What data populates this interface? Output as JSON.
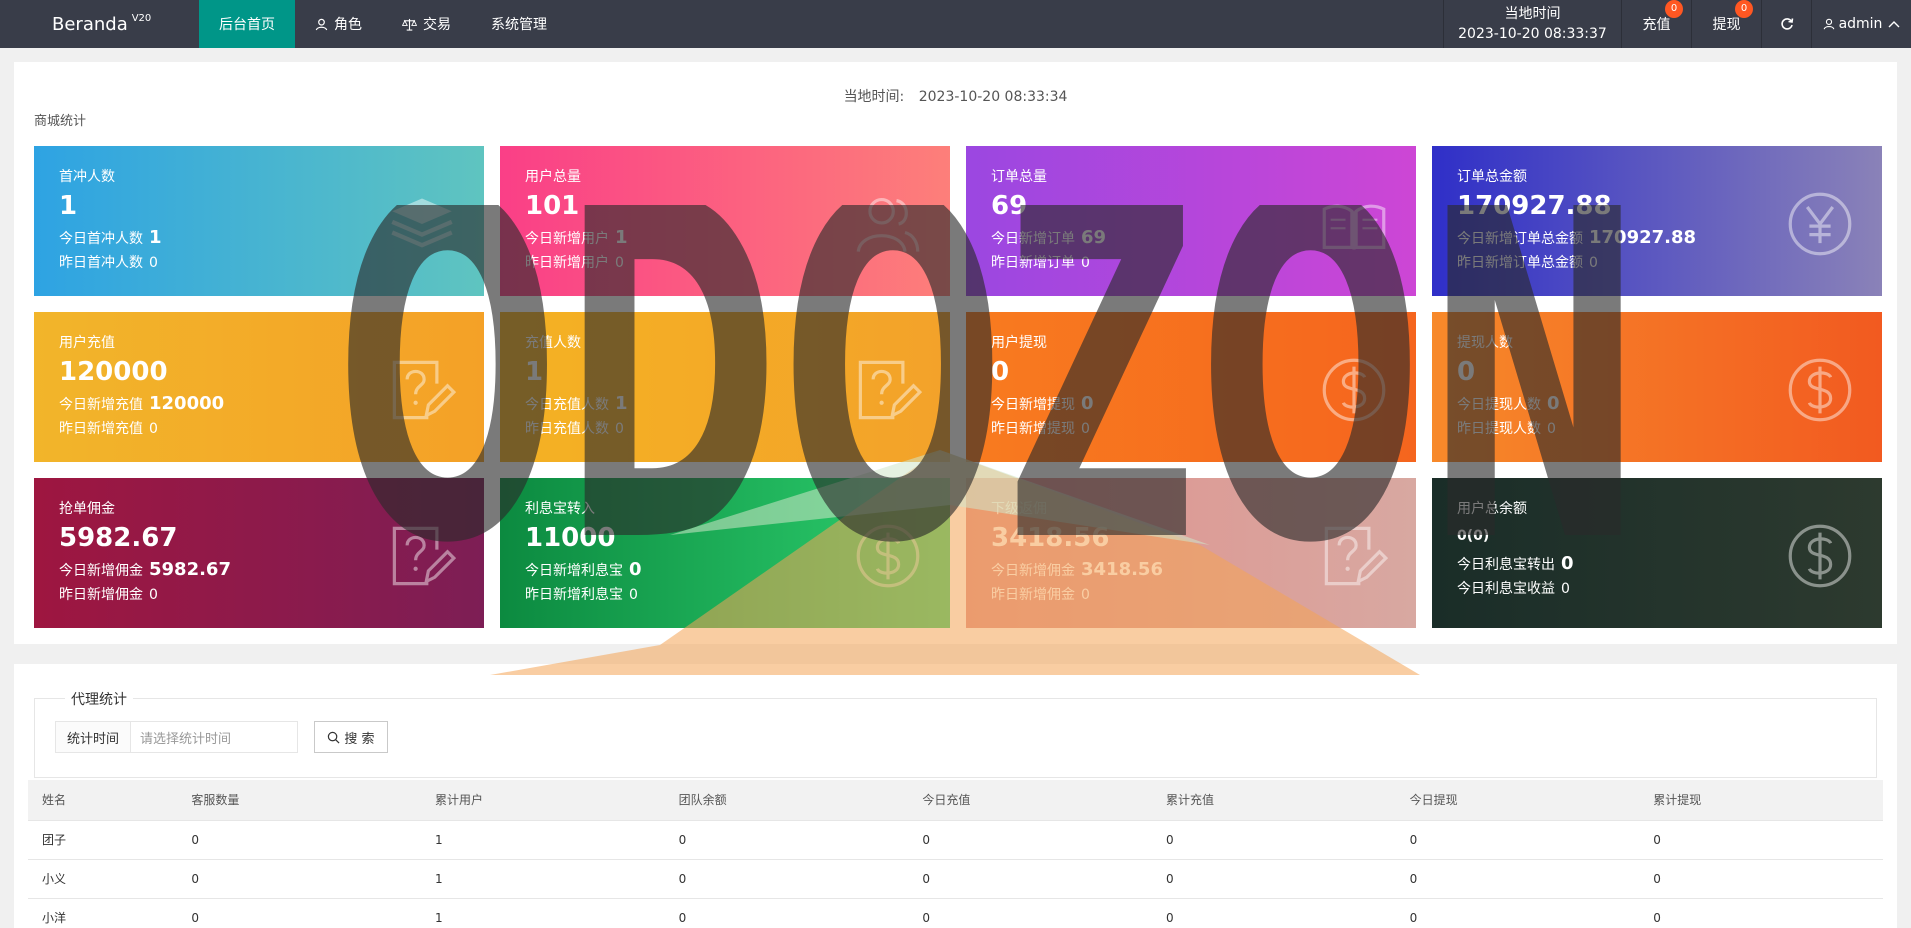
{
  "app": {
    "name": "Beranda",
    "version": "V20"
  },
  "nav": [
    {
      "label": "后台首页",
      "icon": "",
      "active": true
    },
    {
      "label": "角色",
      "icon": "user-icon"
    },
    {
      "label": "交易",
      "icon": "scale-icon"
    },
    {
      "label": "系统管理",
      "icon": ""
    }
  ],
  "header": {
    "time_label": "当地时间",
    "time_value": "2023-10-20 08:33:37",
    "recharge_label": "充值",
    "recharge_count": "0",
    "withdraw_label": "提现",
    "withdraw_count": "0",
    "refresh_icon": "refresh-icon",
    "user_name": "admin"
  },
  "dashboard": {
    "local_time_label": "当地时间:",
    "local_time_value": "2023-10-20 08:33:34",
    "section_title": "商城统计",
    "cards": [
      {
        "title": "首冲人数",
        "value": "1",
        "today_label": "今日首冲人数",
        "today_value": "1",
        "yday_label": "昨日首冲人数",
        "yday_value": "0",
        "icon": "layers-icon",
        "color": "c-blue"
      },
      {
        "title": "用户总量",
        "value": "101",
        "today_label": "今日新增用户",
        "today_value": "1",
        "yday_label": "昨日新增用户",
        "yday_value": "0",
        "icon": "users-icon",
        "color": "c-pink"
      },
      {
        "title": "订单总量",
        "value": "69",
        "today_label": "今日新增订单",
        "today_value": "69",
        "yday_label": "昨日新增订单",
        "yday_value": "0",
        "icon": "book-icon",
        "color": "c-purple"
      },
      {
        "title": "订单总金额",
        "value": "170927.88",
        "today_label": "今日新增订单总金额",
        "today_value": "170927.88",
        "yday_label": "昨日新增订单总金额",
        "yday_value": "0",
        "icon": "yen-icon",
        "color": "c-indigo"
      },
      {
        "title": "用户充值",
        "value": "120000",
        "today_label": "今日新增充值",
        "today_value": "120000",
        "yday_label": "昨日新增充值",
        "yday_value": "0",
        "icon": "edit-icon",
        "color": "c-yellow"
      },
      {
        "title": "充值人数",
        "value": "1",
        "today_label": "今日充值人数",
        "today_value": "1",
        "yday_label": "昨日充值人数",
        "yday_value": "0",
        "icon": "edit-icon",
        "color": "c-yellow2"
      },
      {
        "title": "用户提现",
        "value": "0",
        "today_label": "今日新增提现",
        "today_value": "0",
        "yday_label": "昨日新增提现",
        "yday_value": "0",
        "icon": "dollar-icon",
        "color": "c-orange"
      },
      {
        "title": "提现人数",
        "value": "0",
        "today_label": "今日提现人数",
        "today_value": "0",
        "yday_label": "昨日提现人数",
        "yday_value": "0",
        "icon": "dollar-icon",
        "color": "c-orange2"
      },
      {
        "title": "抢单佣金",
        "value": "5982.67",
        "today_label": "今日新增佣金",
        "today_value": "5982.67",
        "yday_label": "昨日新增佣金",
        "yday_value": "0",
        "icon": "edit-icon",
        "color": "c-crimson"
      },
      {
        "title": "利息宝转入",
        "value": "11000",
        "today_label": "今日新增利息宝",
        "today_value": "0",
        "yday_label": "昨日新增利息宝",
        "yday_value": "0",
        "icon": "dollar-icon",
        "color": "c-green"
      },
      {
        "title": "下级返佣",
        "value": "3418.56",
        "today_label": "今日新增佣金",
        "today_value": "3418.56",
        "yday_label": "昨日新增佣金",
        "yday_value": "0",
        "icon": "edit-icon",
        "color": "c-salmon"
      },
      {
        "title": "用户总余额",
        "value": "0(0)",
        "small": true,
        "today_label": "今日利息宝转出",
        "today_value": "0",
        "yday_label": "今日利息宝收益",
        "yday_value": "0",
        "icon": "dollar-icon",
        "color": "c-dark"
      }
    ]
  },
  "agent": {
    "legend": "代理统计",
    "filter_label": "统计时间",
    "filter_placeholder": "请选择统计时间",
    "search_label": "搜 索",
    "columns": [
      "姓名",
      "客服数量",
      "累计用户",
      "团队余额",
      "今日充值",
      "累计充值",
      "今日提现",
      "累计提现"
    ],
    "rows": [
      [
        "团子",
        "0",
        "1",
        "0",
        "0",
        "0",
        "0",
        "0"
      ],
      [
        "小义",
        "0",
        "1",
        "0",
        "0",
        "0",
        "0",
        "0"
      ],
      [
        "小洋",
        "0",
        "1",
        "0",
        "0",
        "0",
        "0",
        "0"
      ]
    ]
  },
  "watermark": {
    "text": "ODOZON"
  }
}
